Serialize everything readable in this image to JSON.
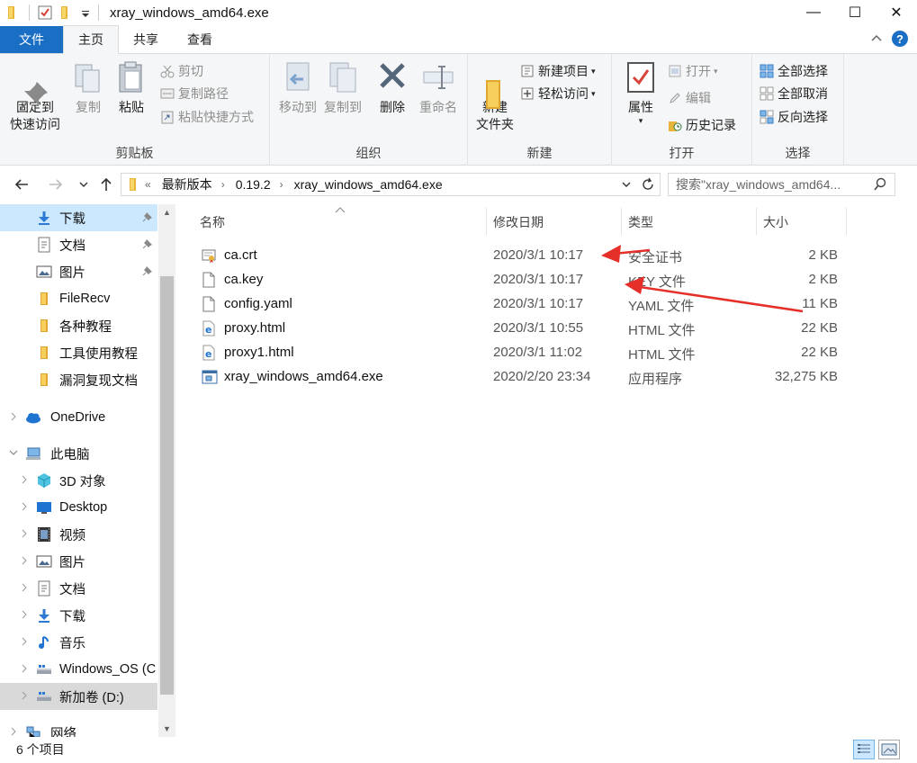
{
  "window": {
    "title": "xray_windows_amd64.exe",
    "controls": [
      "—",
      "☐",
      "✕"
    ]
  },
  "tabs": {
    "file": "文件",
    "home": "主页",
    "share": "共享",
    "view": "查看"
  },
  "ribbon": {
    "clipboard": {
      "label": "剪贴板",
      "pin": "固定到\n快速访问",
      "copy": "复制",
      "paste": "粘贴",
      "cut": "剪切",
      "copy_path": "复制路径",
      "paste_shortcut": "粘贴快捷方式"
    },
    "organize": {
      "label": "组织",
      "move_to": "移动到",
      "copy_to": "复制到",
      "delete": "删除",
      "rename": "重命名"
    },
    "new": {
      "label": "新建",
      "new_folder": "新建\n文件夹",
      "new_item": "新建项目",
      "easy_access": "轻松访问"
    },
    "open": {
      "label": "打开",
      "properties": "属性",
      "open": "打开",
      "edit": "编辑",
      "history": "历史记录"
    },
    "select": {
      "label": "选择",
      "select_all": "全部选择",
      "select_none": "全部取消",
      "invert": "反向选择"
    }
  },
  "address": {
    "prefix": "«",
    "crumbs": [
      "最新版本",
      "0.19.2",
      "xray_windows_amd64.exe"
    ],
    "search_placeholder": "搜索\"xray_windows_amd64..."
  },
  "nav": [
    {
      "label": "下载",
      "icon": "download-icon",
      "pinned": true,
      "selected": true
    },
    {
      "label": "文档",
      "icon": "document-icon",
      "pinned": true
    },
    {
      "label": "图片",
      "icon": "picture-icon",
      "pinned": true
    },
    {
      "label": "FileRecv",
      "icon": "folder-icon"
    },
    {
      "label": "各种教程",
      "icon": "folder-icon"
    },
    {
      "label": "工具使用教程",
      "icon": "folder-icon"
    },
    {
      "label": "漏洞复现文档",
      "icon": "folder-icon"
    },
    {
      "label": "OneDrive",
      "icon": "cloud-icon"
    },
    {
      "label": "此电脑",
      "icon": "computer-icon"
    },
    {
      "label": "3D 对象",
      "icon": "cube-icon"
    },
    {
      "label": "Desktop",
      "icon": "desktop-icon"
    },
    {
      "label": "视频",
      "icon": "video-icon"
    },
    {
      "label": "图片",
      "icon": "picture-icon"
    },
    {
      "label": "文档",
      "icon": "document-icon"
    },
    {
      "label": "下载",
      "icon": "download-icon"
    },
    {
      "label": "音乐",
      "icon": "music-icon"
    },
    {
      "label": "Windows_OS (C",
      "icon": "drive-icon"
    },
    {
      "label": "新加卷 (D:)",
      "icon": "drive-icon"
    },
    {
      "label": "网络",
      "icon": "network-icon"
    }
  ],
  "columns": {
    "name": "名称",
    "date": "修改日期",
    "type": "类型",
    "size": "大小"
  },
  "files": [
    {
      "name": "ca.crt",
      "date": "2020/3/1 10:17",
      "type": "安全证书",
      "size": "2 KB",
      "icon": "certificate-icon"
    },
    {
      "name": "ca.key",
      "date": "2020/3/1 10:17",
      "type": "KEY 文件",
      "size": "2 KB",
      "icon": "file-icon"
    },
    {
      "name": "config.yaml",
      "date": "2020/3/1 10:17",
      "type": "YAML 文件",
      "size": "11 KB",
      "icon": "file-icon"
    },
    {
      "name": "proxy.html",
      "date": "2020/3/1 10:55",
      "type": "HTML 文件",
      "size": "22 KB",
      "icon": "html-icon"
    },
    {
      "name": "proxy1.html",
      "date": "2020/3/1 11:02",
      "type": "HTML 文件",
      "size": "22 KB",
      "icon": "html-icon"
    },
    {
      "name": "xray_windows_amd64.exe",
      "date": "2020/2/20 23:34",
      "type": "应用程序",
      "size": "32,275 KB",
      "icon": "exe-icon"
    }
  ],
  "status": {
    "count": "6 个项目"
  },
  "colors": {
    "accent": "#1a6fc4",
    "selection": "#cce8ff",
    "arrow": "#e5302a"
  }
}
